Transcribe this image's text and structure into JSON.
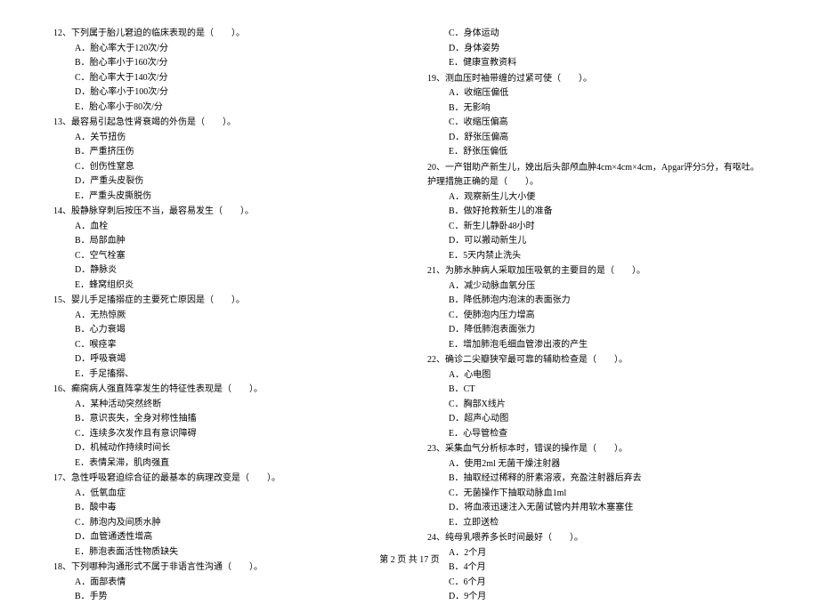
{
  "left": [
    {
      "num": "12、",
      "text": "下列属于胎儿窘迫的临床表现的是（　　）。",
      "opts": [
        "A．胎心率大于120次/分",
        "B．胎心率小于160次/分",
        "C．胎心率大于140次/分",
        "D．胎心率小于100次/分",
        "E．胎心率小于80次/分"
      ]
    },
    {
      "num": "13、",
      "text": "最容易引起急性肾衰竭的外伤是（　　）。",
      "opts": [
        "A．关节扭伤",
        "B．严重挤压伤",
        "C．创伤性窒息",
        "D．严重头皮裂伤",
        "E．严重头皮撕脱伤"
      ]
    },
    {
      "num": "14、",
      "text": "股静脉穿刺后按压不当，最容易发生（　　）。",
      "opts": [
        "A．血栓",
        "B．局部血肿",
        "C．空气栓塞",
        "D．静脉炎",
        "E．蜂窝组织炎"
      ]
    },
    {
      "num": "15、",
      "text": "婴儿手足搐搦症的主要死亡原因是（　　）。",
      "opts": [
        "A．无热惊厥",
        "B．心力衰竭",
        "C．喉痉挛",
        "D．呼吸衰竭",
        "E．手足搐搦、"
      ]
    },
    {
      "num": "16、",
      "text": "癫痫病人强直阵挛发生的特征性表现是（　　）。",
      "opts": [
        "A．某种活动突然终断",
        "B．意识丧失，全身对称性抽搐",
        "C．连续多次发作且有意识障碍",
        "D．机械动作持续时间长",
        "E．表情呆滞，肌肉强直"
      ]
    },
    {
      "num": "17、",
      "text": "急性呼吸窘迫综合征的最基本的病理改变是（　　）。",
      "opts": [
        "A．低氧血症",
        "B．酸中毒",
        "C．肺泡内及间质水肿",
        "D．血管通透性增高",
        "E．肺泡表面活性物质缺失"
      ]
    },
    {
      "num": "18、",
      "text": "下列哪种沟通形式不属于非语言性沟通（　　）。",
      "opts": [
        "A．面部表情",
        "B．手势"
      ]
    }
  ],
  "right": [
    {
      "num": "",
      "text": "",
      "opts": [
        "C．身体运动",
        "D．身体姿势",
        "E．健康宣教资料"
      ]
    },
    {
      "num": "19、",
      "text": "测血压时袖带缠的过紧可使（　　）。",
      "opts": [
        "A．收缩压偏低",
        "B．无影响",
        "C．收缩压偏高",
        "D．舒张压偏高",
        "E．舒张压偏低"
      ]
    },
    {
      "num": "20、",
      "text": "一产钳助产新生儿，娩出后头部颅血肿4cm×4cm×4cm，Apgar评分5分，有呕吐。护理措施正确的是（　　）。",
      "opts": [
        "A．观察新生儿大小便",
        "B．做好抢救新生儿的准备",
        "C．新生儿静卧48小时",
        "D．可以搬动新生儿",
        "E．5天内禁止洗头"
      ]
    },
    {
      "num": "21、",
      "text": "为肺水肿病人采取加压吸氧的主要目的是（　　）。",
      "opts": [
        "A．减少动脉血氧分压",
        "B．降低肺泡内泡沫的表面张力",
        "C．使肺泡内压力增高",
        "D．降低肺泡表面张力",
        "E．增加肺泡毛细血管渗出液的产生"
      ]
    },
    {
      "num": "22、",
      "text": "确诊二尖瓣狭窄最可靠的辅助检查是（　　）。",
      "opts": [
        "A．心电图",
        "B．CT",
        "C．胸部X线片",
        "D．超声心动图",
        "E．心导管检查"
      ]
    },
    {
      "num": "23、",
      "text": "采集血气分析标本时，错误的操作是（　　）。",
      "opts": [
        "A．使用2ml 无菌干燥注射器",
        "B．抽取经过稀释的肝素溶液，充盈注射器后弃去",
        "C．无菌操作下抽取动脉血1ml",
        "D．将血液迅速注入无菌试管内并用软木塞塞住",
        "E．立即送检"
      ]
    },
    {
      "num": "24、",
      "text": "纯母乳喂养多长时间最好（　　）。",
      "opts": [
        "A．2个月",
        "B．4个月",
        "C．6个月",
        "D．9个月"
      ]
    }
  ],
  "footer": "第 2 页 共 17 页"
}
